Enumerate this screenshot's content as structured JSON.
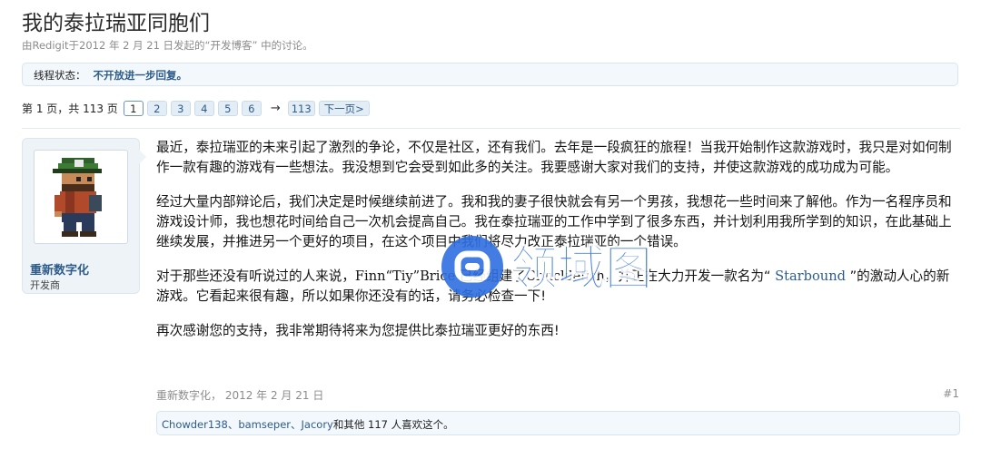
{
  "thread": {
    "title": "我的泰拉瑞亚同胞们",
    "subtitle": "由Redigit于2012 年 2 月 21 日发起的“开发博客” 中的讨论。",
    "status_label": "线程状态：",
    "status_value": "不开放进一步回复。"
  },
  "pager": {
    "info": "第 1 页，共 113 页",
    "pages": [
      "1",
      "2",
      "3",
      "4",
      "5",
      "6"
    ],
    "arrow": "→",
    "last": "113",
    "next": "下一页>"
  },
  "post": {
    "author": "重新数字化",
    "author_title": "开发商",
    "p1": "最近，泰拉瑞亚的未来引起了激烈的争论，不仅是社区，还有我们。去年是一段疯狂的旅程！当我开始制作这款游戏时，我只是对如何制作一款有趣的游戏有一些想法。我没想到它会受到如此多的关注。我要感谢大家对我们的支持，并使这款游戏的成功成为可能。",
    "p2": "经过大量内部辩论后，我们决定是时候继续前进了。我和我的妻子很快就会有另一个男孩，我想花一些时间来了解他。作为一名程序员和游戏设计师，我也想花时间给自己一次机会提高自己。我在泰拉瑞亚的工作中学到了很多东西，并计划利用我所学到的知识，在此基础上继续发展，并推进另一个更好的项目，在这个项目中我们将尽力改正泰拉瑞亚的一个错误。",
    "p3_a": "对于那些还没有听说过的人来说，",
    "p3_b": "Finn“Tiy”Brice",
    "p3_c": " 已经组建了",
    "p3_d": "Chucklefish",
    "p3_e": "，并正在大力开发一款名为“",
    "p3_f": " Starbound ",
    "p3_g": "”的激动人心的新游戏。它看起来很有趣，所以如果你还没有的话，请务必检查一下!",
    "p4": "再次感谢您的支持，我非常期待将来为您提供比泰拉瑞亚更好的东西!",
    "meta": "重新数字化， 2012 年 2 月 21 日",
    "number": "#1",
    "likes_names": "Chowder138、bamseper、Jacory",
    "likes_rest": "和其他 117 人喜欢这个。"
  },
  "watermark": {
    "text": "领域图"
  },
  "colors": {
    "link": "#2e5c8a",
    "box_bg": "#f3f8fd",
    "watermark": "#2f6fe0"
  }
}
